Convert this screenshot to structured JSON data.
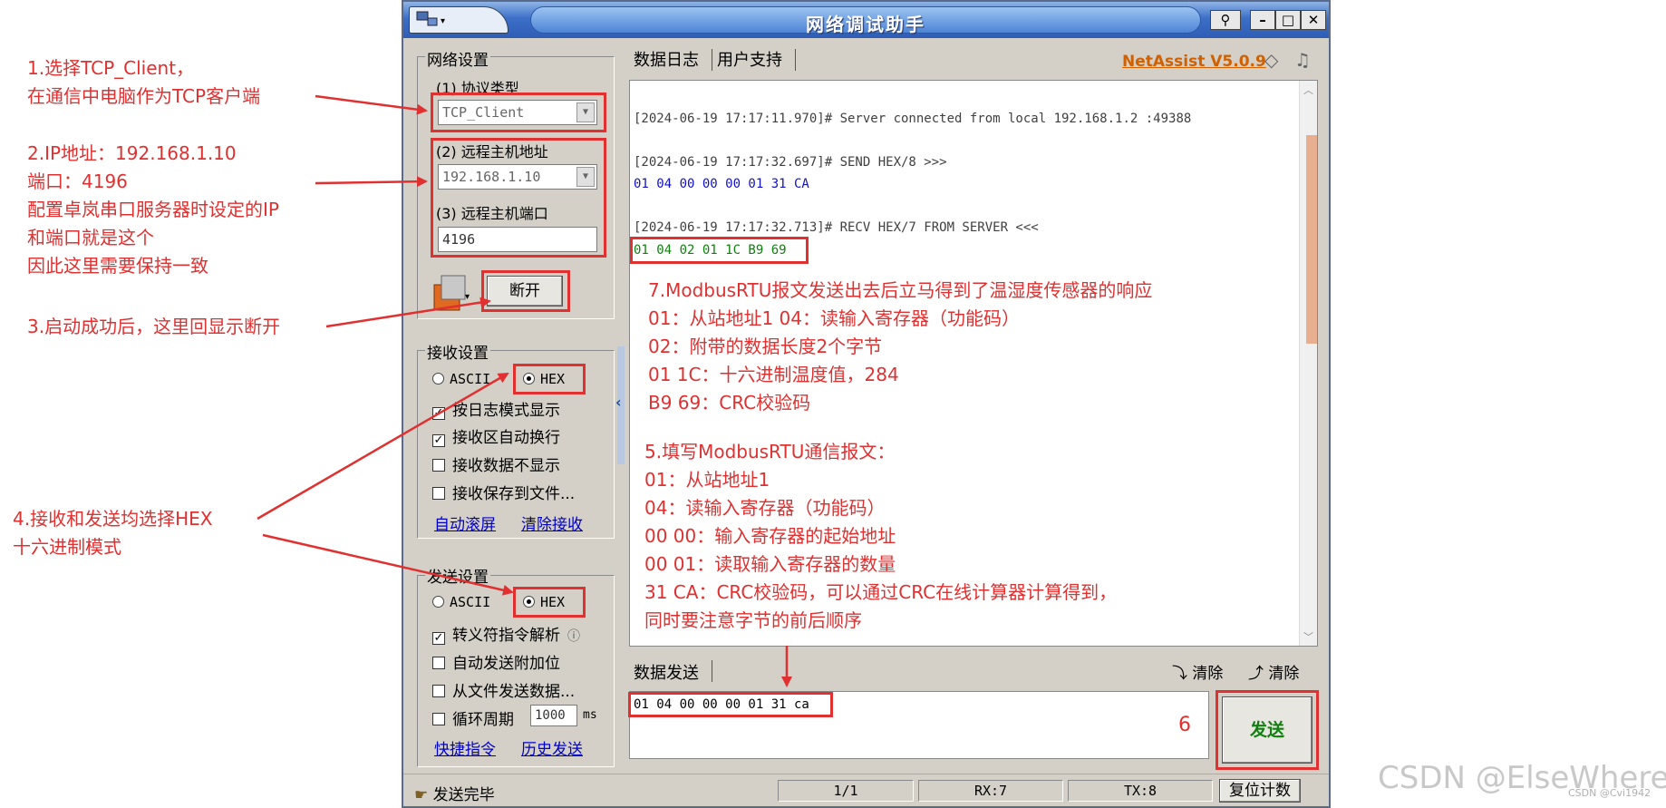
{
  "annotations": {
    "step1": [
      "1.选择TCP_Client，",
      "在通信中电脑作为TCP客户端"
    ],
    "step2": [
      "2.IP地址：192.168.1.10",
      "端口：4196",
      "配置卓岚串口服务器时设定的IP",
      "和端口就是这个",
      "因此这里需要保持一致"
    ],
    "step3": [
      "3.启动成功后，这里回显示断开"
    ],
    "step4": [
      "4.接收和发送均选择HEX",
      "十六进制模式"
    ],
    "step6": "6"
  },
  "window": {
    "title": "网络调试助手",
    "brand": "NetAssist V5.0.9"
  },
  "network": {
    "group_label": "网络设置",
    "protocol_label": "(1) 协议类型",
    "protocol_value": "TCP_Client",
    "host_label": "(2) 远程主机地址",
    "host_value": "192.168.1.10",
    "port_label": "(3) 远程主机端口",
    "port_value": "4196",
    "disconnect_label": "断开"
  },
  "receive": {
    "group_label": "接收设置",
    "ascii": "ASCII",
    "hex": "HEX",
    "opt1": "按日志模式显示",
    "opt2": "接收区自动换行",
    "opt3": "接收数据不显示",
    "opt4": "接收保存到文件...",
    "link1": "自动滚屏",
    "link2": "清除接收"
  },
  "send": {
    "group_label": "发送设置",
    "ascii": "ASCII",
    "hex": "HEX",
    "opt1": "转义符指令解析",
    "opt2": "自动发送附加位",
    "opt3": "从文件发送数据...",
    "opt4": "循环周期",
    "period": "1000",
    "unit": "ms",
    "link1": "快捷指令",
    "link2": "历史发送"
  },
  "tabs": {
    "log": "数据日志",
    "support": "用户支持",
    "send": "数据发送",
    "clear1": "清除",
    "clear2": "清除"
  },
  "log": {
    "line1": "[2024-06-19 17:17:11.970]# Server connected from local 192.168.1.2 :49388",
    "line2": "[2024-06-19 17:17:32.697]# SEND HEX/8 >>>",
    "line3": "01 04 00 00 00 01 31 CA",
    "line4": "[2024-06-19 17:17:32.713]# RECV HEX/7 FROM SERVER <<<",
    "line5": "01 04 02 01 1C B9 69"
  },
  "notes7": [
    "7.ModbusRTU报文发送出去后立马得到了温湿度传感器的响应",
    "01：从站地址1          04：读输入寄存器（功能码）",
    "02：附带的数据长度2个字节",
    "01 1C：十六进制温度值，284",
    "B9 69：CRC校验码"
  ],
  "notes5": [
    "5.填写ModbusRTU通信报文：",
    "01：从站地址1",
    "04：读输入寄存器（功能码）",
    "00 00：输入寄存器的起始地址",
    "00 01：读取输入寄存器的数量",
    "31 CA：CRC校验码，可以通过CRC在线计算器计算得到，",
    "同时要注意字节的前后顺序"
  ],
  "send_text": "01 04 00 00 00 01 31 ca",
  "send_button": "发送",
  "status": {
    "message": "发送完毕",
    "page": "1/1",
    "rx": "RX:7",
    "tx": "TX:8",
    "reset": "复位计数"
  },
  "watermark": "CSDN @ElseWhereR",
  "watermark_small": "CSDN @Cvi1942"
}
